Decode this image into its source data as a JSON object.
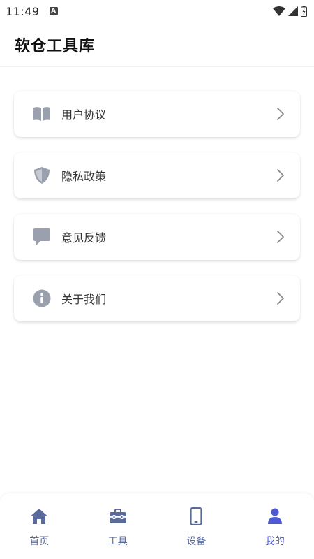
{
  "status_bar": {
    "time": "11:49",
    "app_icon_letter": "A",
    "icons": [
      "wifi-icon",
      "signal-icon",
      "battery-icon"
    ]
  },
  "header": {
    "title": "软仓工具库"
  },
  "menu": [
    {
      "label": "用户协议",
      "icon": "book-icon"
    },
    {
      "label": "隐私政策",
      "icon": "shield-icon"
    },
    {
      "label": "意见反馈",
      "icon": "chat-bubble-icon"
    },
    {
      "label": "关于我们",
      "icon": "info-icon"
    }
  ],
  "bottom_nav": {
    "active_index": 3,
    "items": [
      {
        "label": "首页",
        "icon": "home-icon"
      },
      {
        "label": "工具",
        "icon": "toolbox-icon"
      },
      {
        "label": "设备",
        "icon": "phone-icon"
      },
      {
        "label": "我的",
        "icon": "user-icon"
      }
    ]
  },
  "colors": {
    "icon_gray": "#9aa0ad",
    "chevron": "#8a8a8a",
    "nav_inactive": "#5a6a9a",
    "nav_active": "#4f5bd5"
  }
}
